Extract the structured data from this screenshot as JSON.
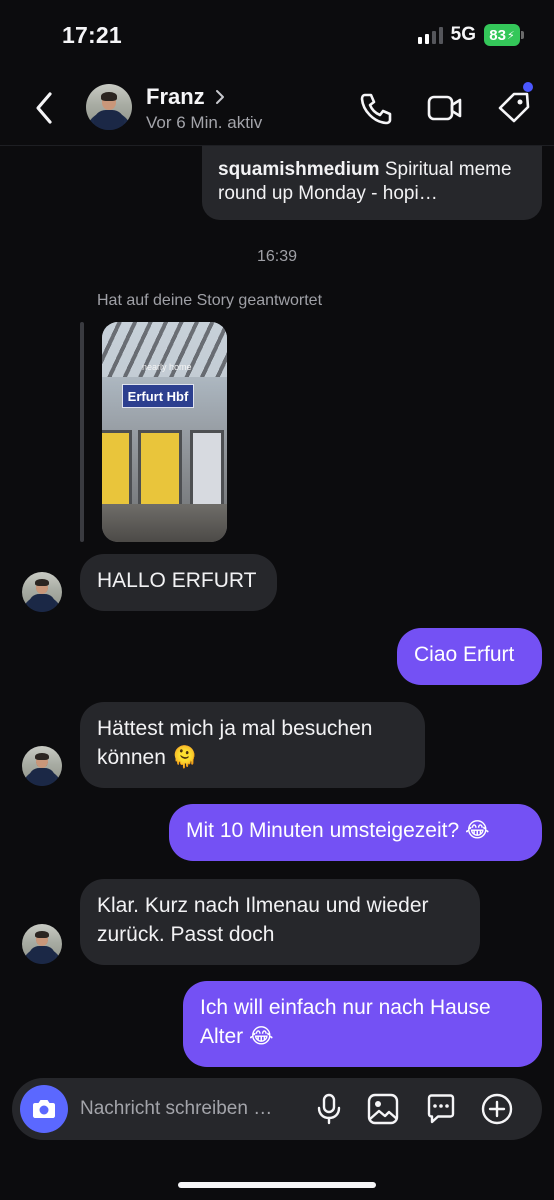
{
  "status_bar": {
    "time": "17:21",
    "network": "5G",
    "battery": "83"
  },
  "header": {
    "contact_name": "Franz",
    "contact_status": "Vor 6 Min. aktiv",
    "icons": [
      "back-icon",
      "phone-icon",
      "video-camera-icon",
      "tag-icon"
    ]
  },
  "shared_post": {
    "username": "squamishmedium",
    "caption": "Spiritual meme round up Monday - hopi…"
  },
  "timestamp": "16:39",
  "story_reply": {
    "label": "Hat auf deine Story geantwortet",
    "sign_text": "Erfurt Hbf",
    "watermark": "nearly home"
  },
  "messages": [
    {
      "from": "them",
      "text": "HALLO ERFURT"
    },
    {
      "from": "me",
      "text": "Ciao Erfurt"
    },
    {
      "from": "them",
      "text": "Hättest mich ja mal besuchen",
      "text2": "können",
      "emoji": "🫠"
    },
    {
      "from": "me",
      "text": "Mit 10 Minuten umsteigezeit?",
      "emoji": "😂"
    },
    {
      "from": "them",
      "text": "Klar. Kurz nach Ilmenau und wieder",
      "text2": "zurück. Passt doch"
    },
    {
      "from": "me",
      "text": "Ich will einfach nur nach Hause",
      "text2": "Alter",
      "emoji": "😂"
    }
  ],
  "composer": {
    "placeholder": "Nachricht schreiben …",
    "icons": [
      "camera-icon",
      "microphone-icon",
      "image-icon",
      "sticker-icon",
      "plus-circle-icon"
    ]
  },
  "colors": {
    "outgoing_bubble": "#7451f4",
    "incoming_bubble": "#26272b",
    "accent": "#5b68ff",
    "background": "#0c0c0e"
  }
}
